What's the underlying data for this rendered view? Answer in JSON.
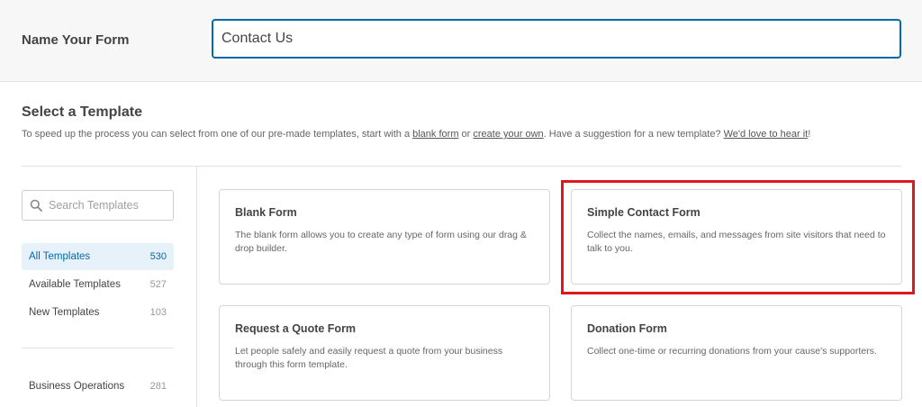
{
  "header": {
    "label": "Name Your Form",
    "input_value": "Contact Us"
  },
  "section": {
    "title": "Select a Template",
    "desc_prefix": "To speed up the process you can select from one of our pre-made templates, start with a ",
    "link_blank": "blank form",
    "desc_or": " or ",
    "link_create": "create your own",
    "desc_mid": ". Have a suggestion for a new template? ",
    "link_suggest": "We'd love to hear it",
    "desc_end": "!"
  },
  "sidebar": {
    "search_placeholder": "Search Templates",
    "categories": [
      {
        "label": "All Templates",
        "count": "530"
      },
      {
        "label": "Available Templates",
        "count": "527"
      },
      {
        "label": "New Templates",
        "count": "103"
      }
    ],
    "groups": [
      {
        "label": "Business Operations",
        "count": "281"
      }
    ]
  },
  "templates": [
    {
      "title": "Blank Form",
      "desc": "The blank form allows you to create any type of form using our drag & drop builder."
    },
    {
      "title": "Simple Contact Form",
      "desc": "Collect the names, emails, and messages from site visitors that need to talk to you."
    },
    {
      "title": "Request a Quote Form",
      "desc": "Let people safely and easily request a quote from your business through this form template."
    },
    {
      "title": "Donation Form",
      "desc": "Collect one-time or recurring donations from your cause's supporters."
    }
  ],
  "colors": {
    "accent": "#036aab",
    "highlight": "#e0181e",
    "active_bg": "#e6f1f9"
  }
}
